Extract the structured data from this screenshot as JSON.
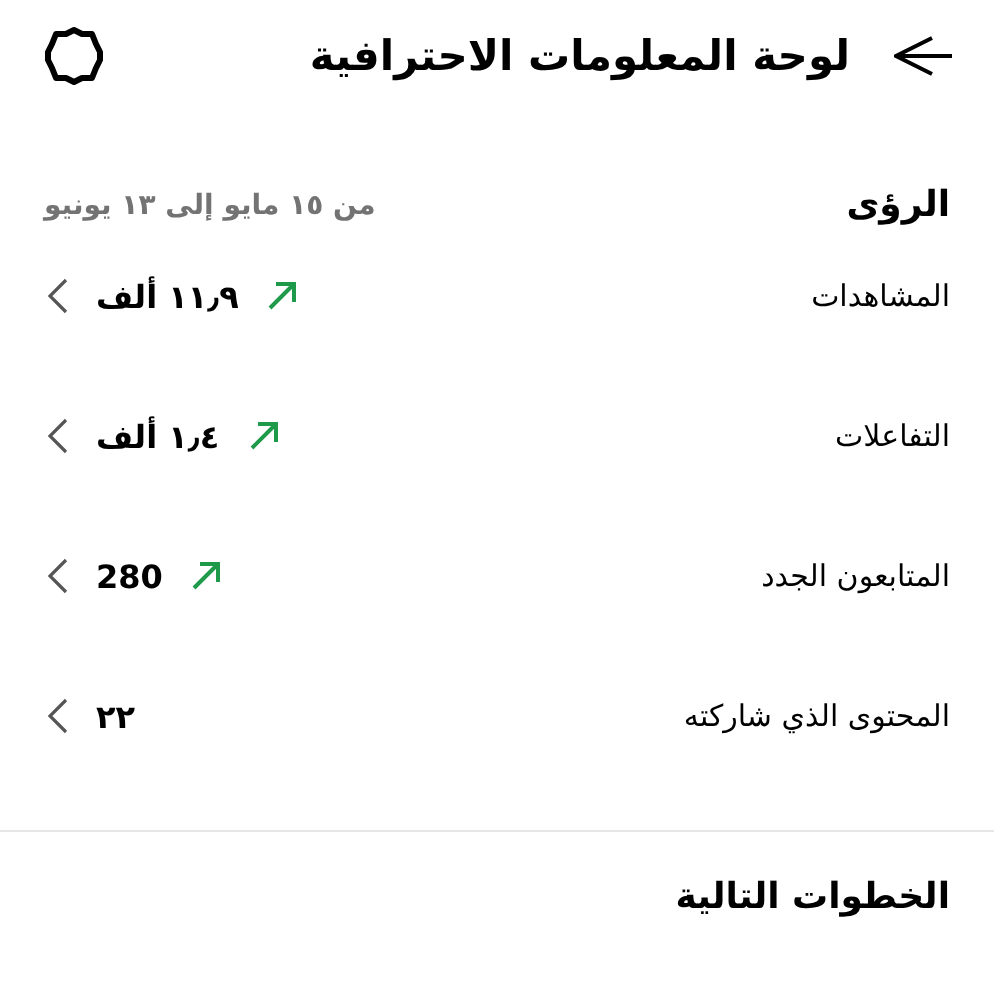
{
  "header": {
    "title": "لوحة المعلومات الاحترافية"
  },
  "insights": {
    "heading": "الرؤى",
    "date_range": "من ١٥ مايو إلى ١٣ يونيو",
    "rows": [
      {
        "label": "المشاهدات",
        "value": "١١٫٩ ألف",
        "trend_up": true
      },
      {
        "label": "التفاعلات",
        "value": "١٫٤ ألف",
        "trend_up": true
      },
      {
        "label": "المتابعون الجدد",
        "value": "280",
        "trend_up": true
      },
      {
        "label": "المحتوى الذي شاركته",
        "value": "٢٢",
        "trend_up": false
      }
    ]
  },
  "next_steps": {
    "heading": "الخطوات التالية"
  }
}
